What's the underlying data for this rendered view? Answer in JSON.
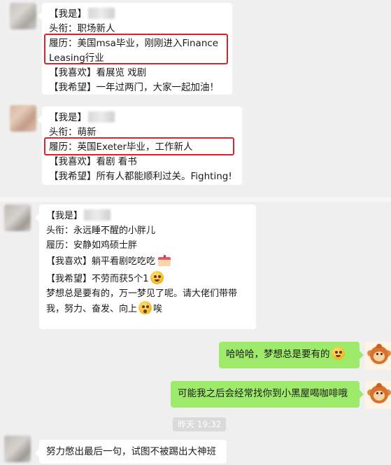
{
  "card1": {
    "name_label": "【我是】",
    "title_line": "头衔：职场新人",
    "resume_line1": "履历：美国msa毕业，刚刚进入Finance",
    "resume_line2": "Leasing行业",
    "likes_line": "【我喜欢】看展览 戏剧",
    "hope_line": "【我希望】一年过两门，大家一起加油！"
  },
  "card2": {
    "name_label": "【我是】",
    "title_line": "头衔：萌新",
    "resume_line": "履历：英国Exeter毕业，工作新人",
    "likes_line": "【我喜欢】看剧 看书",
    "hope_line": "【我希望】所有人都能顺利过关。Fighting!"
  },
  "card3": {
    "name_label": "【我是】",
    "title_line": "头衔：永远睡不醒的小胖儿",
    "resume_line": "履历：安静如鸡硕士胖",
    "likes_line": "【我喜欢】躺平看剧吃吃吃",
    "hope_line": "【我希望】不劳而获5个1",
    "dream_line1": "梦想总是要有的，万一梦见了呢。请大佬们带带",
    "dream_line2_a": "我，努力、奋发、向上",
    "dream_line2_b": "唉"
  },
  "reply1": {
    "text": "哈哈哈，梦想总是要有的"
  },
  "reply2": {
    "text": "可能我之后会经常找你到小黑屋喝咖啡哦"
  },
  "timestamp": "昨天 19:32",
  "last_message": {
    "text": "努力憋出最后一句，试图不被踢出大神班"
  },
  "colors": {
    "highlight_border": "#d8232a",
    "sent_bubble": "#9eea6a",
    "received_bubble": "#ffffff"
  },
  "icons": {
    "avatar_self": "monkey-avatar-icon",
    "emoji_grin": "grin-emoji-icon",
    "emoji_cake": "cake-emoji-icon"
  }
}
